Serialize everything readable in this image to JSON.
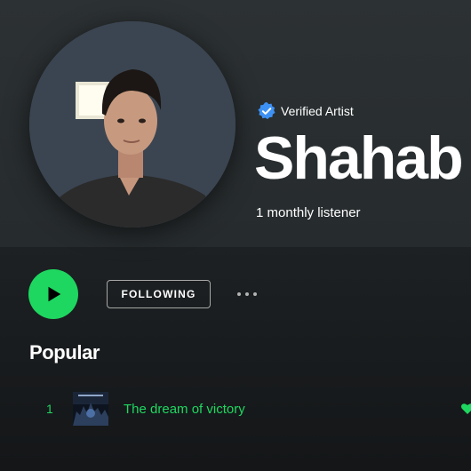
{
  "artist": {
    "name": "Shahab",
    "verified_label": "Verified Artist",
    "monthly_listeners": "1 monthly listener"
  },
  "actions": {
    "play_icon": "play-icon",
    "follow_label": "FOLLOWING",
    "more_icon": "more-options-icon"
  },
  "popular": {
    "title": "Popular",
    "tracks": [
      {
        "index": "1",
        "title": "The dream of victory",
        "liked": true
      }
    ]
  },
  "colors": {
    "accent": "#1ed760",
    "verified_blue": "#3d91f4",
    "background": "#121212"
  }
}
